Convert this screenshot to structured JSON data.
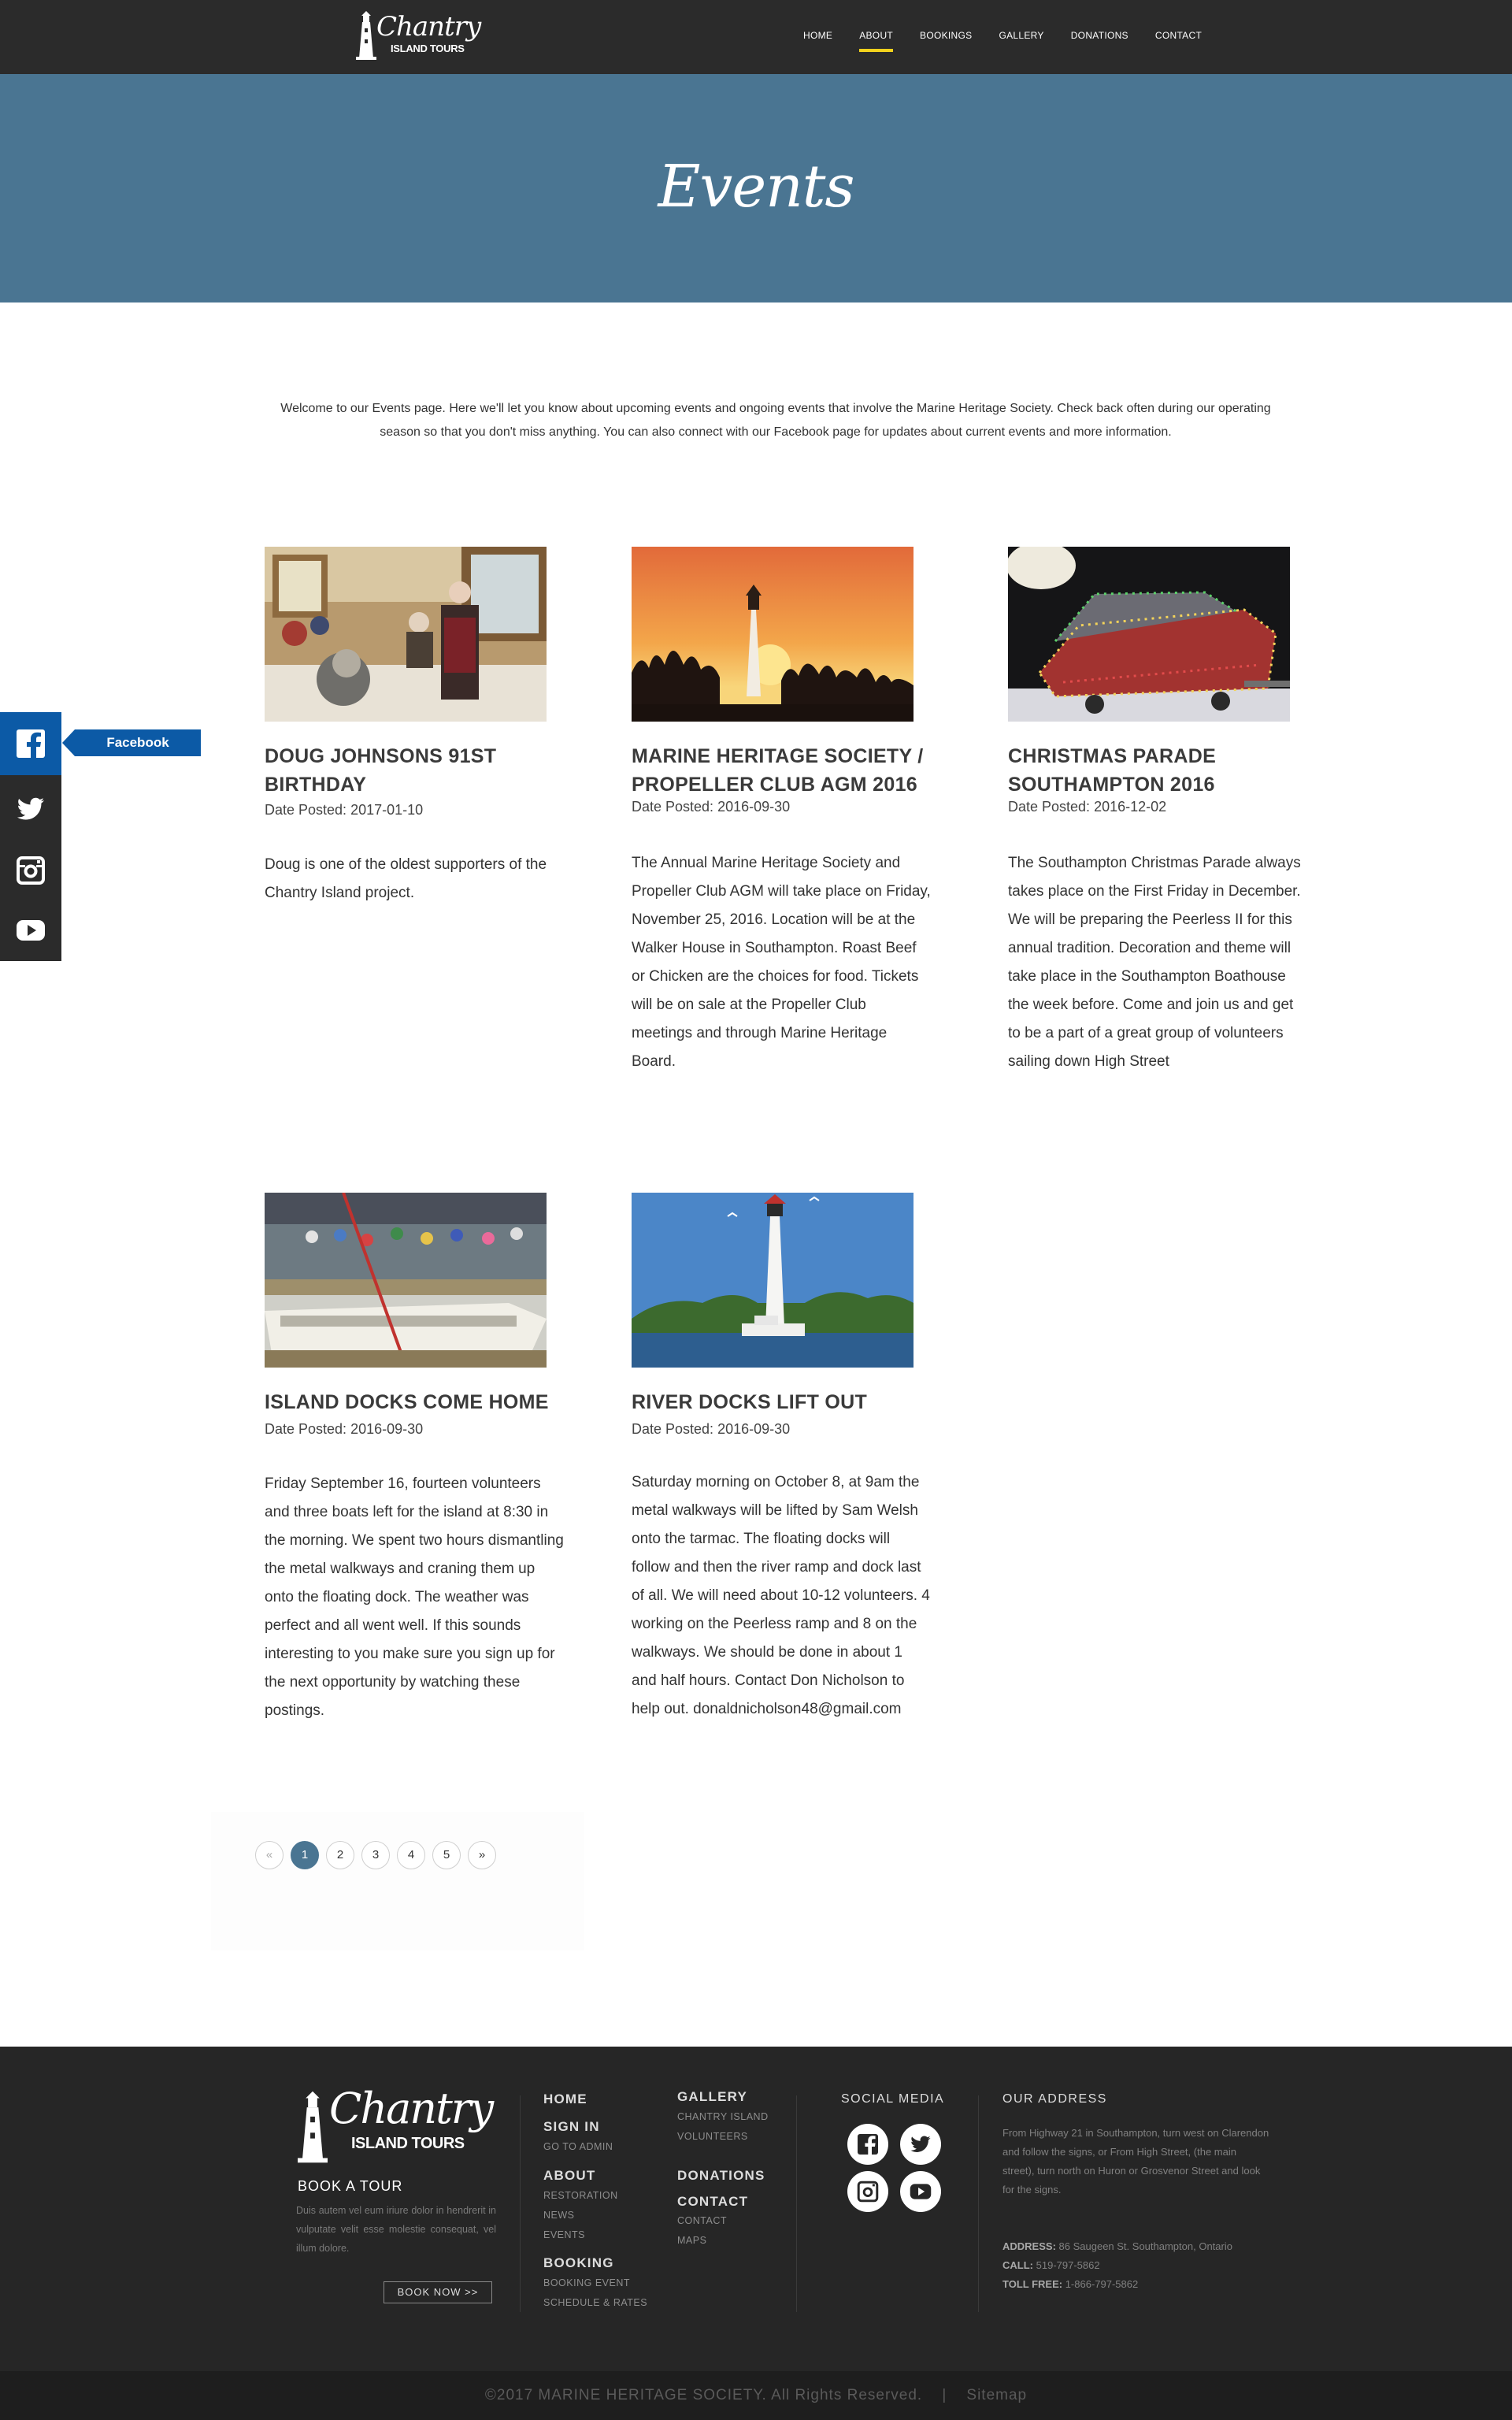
{
  "header": {
    "logo_script": "Chantry",
    "logo_sub": "ISLAND TOURS",
    "nav": [
      {
        "label": "HOME"
      },
      {
        "label": "ABOUT"
      },
      {
        "label": "BOOKINGS"
      },
      {
        "label": "GALLERY"
      },
      {
        "label": "DONATIONS"
      },
      {
        "label": "CONTACT"
      }
    ],
    "active_nav": "ABOUT"
  },
  "hero": {
    "title": "Events",
    "color": "#4a7592"
  },
  "intro": "Welcome to our Events page. Here we'll let you know about upcoming events and ongoing events that involve the Marine Heritage Society. Check back often during our operating season so that you don't miss anything. You can also connect with our Facebook page for updates about current events and more information.",
  "social_sidebar": {
    "tag_label": "Facebook",
    "icons": [
      "facebook-icon",
      "twitter-icon",
      "instagram-icon",
      "youtube-icon"
    ]
  },
  "events": [
    {
      "title": "DOUG JOHNSONS 91ST BIRTHDAY",
      "date": "Date Posted: 2017-01-10",
      "body": "Doug is one of the oldest supporters of the Chantry Island project."
    },
    {
      "title": "MARINE HERITAGE SOCIETY / PROPELLER CLUB AGM 2016",
      "date": "Date Posted: 2016-09-30",
      "body": "The Annual Marine Heritage Society and Propeller Club AGM will take place on Friday, November 25, 2016. Location will be at the Walker House in Southampton. Roast Beef or Chicken are the choices for food. Tickets will be on sale at the Propeller Club meetings and through Marine Heritage Board."
    },
    {
      "title": "CHRISTMAS PARADE SOUTHAMPTON 2016",
      "date": "Date Posted: 2016-12-02",
      "body": "The Southampton Christmas Parade always takes place on the First Friday in December. We will be preparing the Peerless II for this annual tradition. Decoration and theme will take place in the Southampton Boathouse the week before. Come and join us and get to be a part of a great group of volunteers sailing down High Street"
    },
    {
      "title": "ISLAND DOCKS COME HOME",
      "date": "Date Posted: 2016-09-30",
      "body": "Friday September 16, fourteen volunteers and three boats left for the island at 8:30 in the morning. We spent two hours dismantling the metal walkways and craning them up onto the floating dock. The weather was perfect and all went well. If this sounds interesting to you make sure you sign up for the next opportunity by watching these postings."
    },
    {
      "title": "RIVER DOCKS LIFT OUT",
      "date": "Date Posted: 2016-09-30",
      "body": "Saturday morning on October 8, at 9am the metal walkways will be lifted by Sam Welsh onto the tarmac. The floating docks will follow and then the river ramp and dock last of all. We will need about 10-12 volunteers. 4 working on the Peerless ramp and 8 on the walkways. We should be done in about 1 and half hours. Contact Don Nicholson to help out. donaldnicholson48@gmail.com"
    }
  ],
  "pagination": {
    "prev": "«",
    "pages": [
      "1",
      "2",
      "3",
      "4",
      "5"
    ],
    "next": "»",
    "current": "1"
  },
  "footer": {
    "logo_script": "Chantry",
    "logo_sub": "ISLAND TOURS",
    "book_title": "BOOK A TOUR",
    "book_text": "Duis autem vel eum iriure dolor in hendrerit in vulputate velit esse molestie consequat, vel illum dolore.",
    "book_button": "BOOK NOW >>",
    "col1": {
      "home": "HOME",
      "sign_in": "SIGN IN",
      "go_to_admin": "GO TO ADMIN",
      "about": "ABOUT",
      "restoration": "RESTORATION",
      "news": "NEWS",
      "events": "EVENTS",
      "booking": "BOOKING",
      "booking_event": "BOOKING EVENT",
      "schedule_rates": "SCHEDULE & RATES"
    },
    "col2": {
      "gallery": "GALLERY",
      "chantry_island": "CHANTRY ISLAND",
      "volunteers": "VOLUNTEERS",
      "donations": "DONATIONS",
      "contact_head": "CONTACT",
      "contact": "CONTACT",
      "maps": "MAPS"
    },
    "social_title": "SOCIAL MEDIA",
    "address_title": "OUR ADDRESS",
    "address_text": "From Highway 21 in Southampton, turn west on Clarendon and follow the signs, or From High Street, (the main street), turn north on Huron or Grosvenor Street and look for the signs.",
    "address_label": "ADDRESS:",
    "address_value": "86 Saugeen St. Southampton, Ontario",
    "call_label": "CALL:",
    "call_value": "519-797-5862",
    "tollfree_label": "TOLL FREE:",
    "tollfree_value": "1-866-797-5862"
  },
  "bottom": {
    "copyright": "©2017 MARINE HERITAGE SOCIETY. All Rights Reserved.",
    "separator": "|",
    "sitemap": "Sitemap"
  }
}
